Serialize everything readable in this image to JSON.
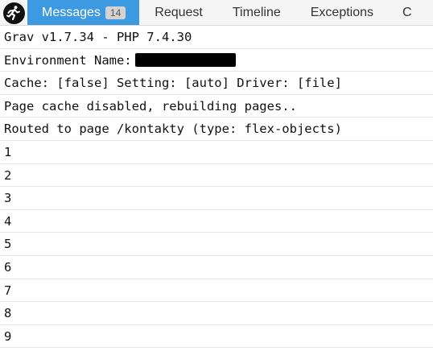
{
  "tabs": [
    {
      "label": "Messages",
      "badge": "14"
    },
    {
      "label": "Request"
    },
    {
      "label": "Timeline"
    },
    {
      "label": "Exceptions"
    },
    {
      "label": "C"
    }
  ],
  "messages": [
    "Grav v1.7.34 - PHP 7.4.30",
    "Environment Name:",
    "Cache: [false] Setting: [auto] Driver: [file]",
    "Page cache disabled, rebuilding pages..",
    "Routed to page /kontakty (type: flex-objects)",
    "1",
    "2",
    "3",
    "4",
    "5",
    "6",
    "7",
    "8",
    "9"
  ]
}
